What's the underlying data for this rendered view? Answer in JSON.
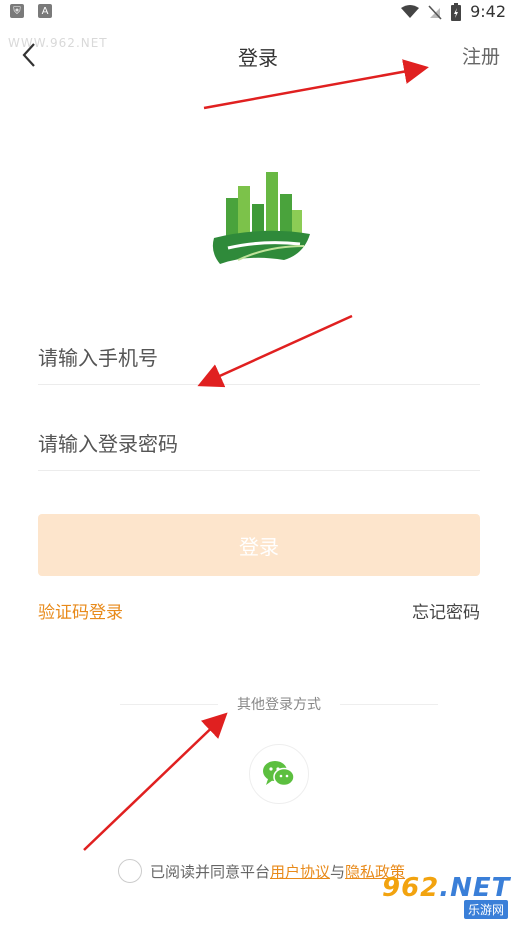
{
  "status_bar": {
    "time": "9:42"
  },
  "watermark_top": "WWW.962.NET",
  "nav": {
    "title": "登录",
    "register_label": "注册"
  },
  "form": {
    "phone_placeholder": "请输入手机号",
    "password_placeholder": "请输入登录密码",
    "login_button": "登录",
    "code_login": "验证码登录",
    "forgot_password": "忘记密码"
  },
  "other_login": {
    "label": "其他登录方式"
  },
  "agreement": {
    "prefix": "已阅读并同意平台",
    "user_agreement": "用户协议",
    "conjunction": "与",
    "privacy_policy": "隐私政策"
  },
  "watermark_br": {
    "main_prefix": "962",
    "main_suffix": ".NET",
    "sub": "乐游网"
  },
  "colors": {
    "accent": "#e88a1a",
    "button_bg": "#fde5cc",
    "logo_green": "#3a9a3a",
    "wechat_green": "#5cbf3f",
    "annotation_red": "#e02020"
  }
}
